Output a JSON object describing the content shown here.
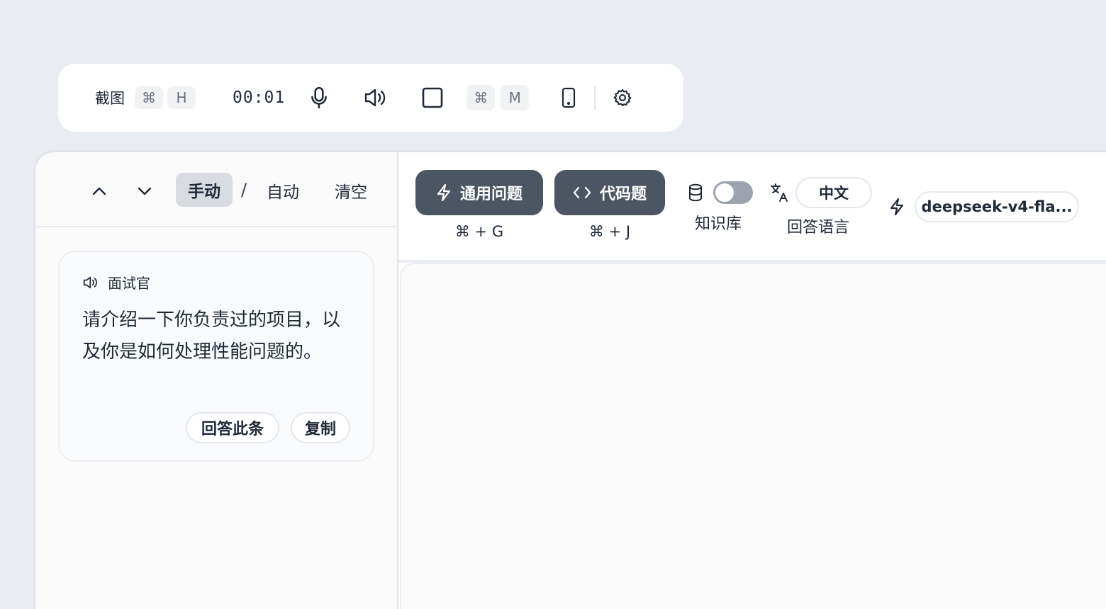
{
  "toolbar": {
    "screenshot_label": "截图",
    "screenshot_keys": [
      "⌘",
      "H"
    ],
    "timer": "00:01",
    "mode_keys": [
      "⌘",
      "M"
    ],
    "icons": [
      "microphone-icon",
      "speaker-icon",
      "stop-square-icon",
      "phone-icon",
      "gear-icon"
    ]
  },
  "left": {
    "modes": {
      "manual": "手动",
      "separator": "/",
      "auto": "自动",
      "clear": "清空"
    },
    "transcript": {
      "speaker": "面试官",
      "text": "请介绍一下你负责过的项目，以及你是如何处理性能问题的。",
      "answer_label": "回答此条",
      "copy_label": "复制"
    }
  },
  "right": {
    "general_button": "通用问题",
    "general_shortcut": "⌘ + G",
    "code_button": "代码题",
    "code_shortcut": "⌘ + J",
    "knowledge_base_label": "知识库",
    "knowledge_base_enabled": false,
    "language_value": "中文",
    "language_label": "回答语言",
    "model_name": "deepseek-v4-fla..."
  },
  "colors": {
    "background": "#e9ecf1",
    "action_button": "#4b5563",
    "toggle_off": "#9ca3af",
    "active_mode": "#d8dbe0"
  }
}
